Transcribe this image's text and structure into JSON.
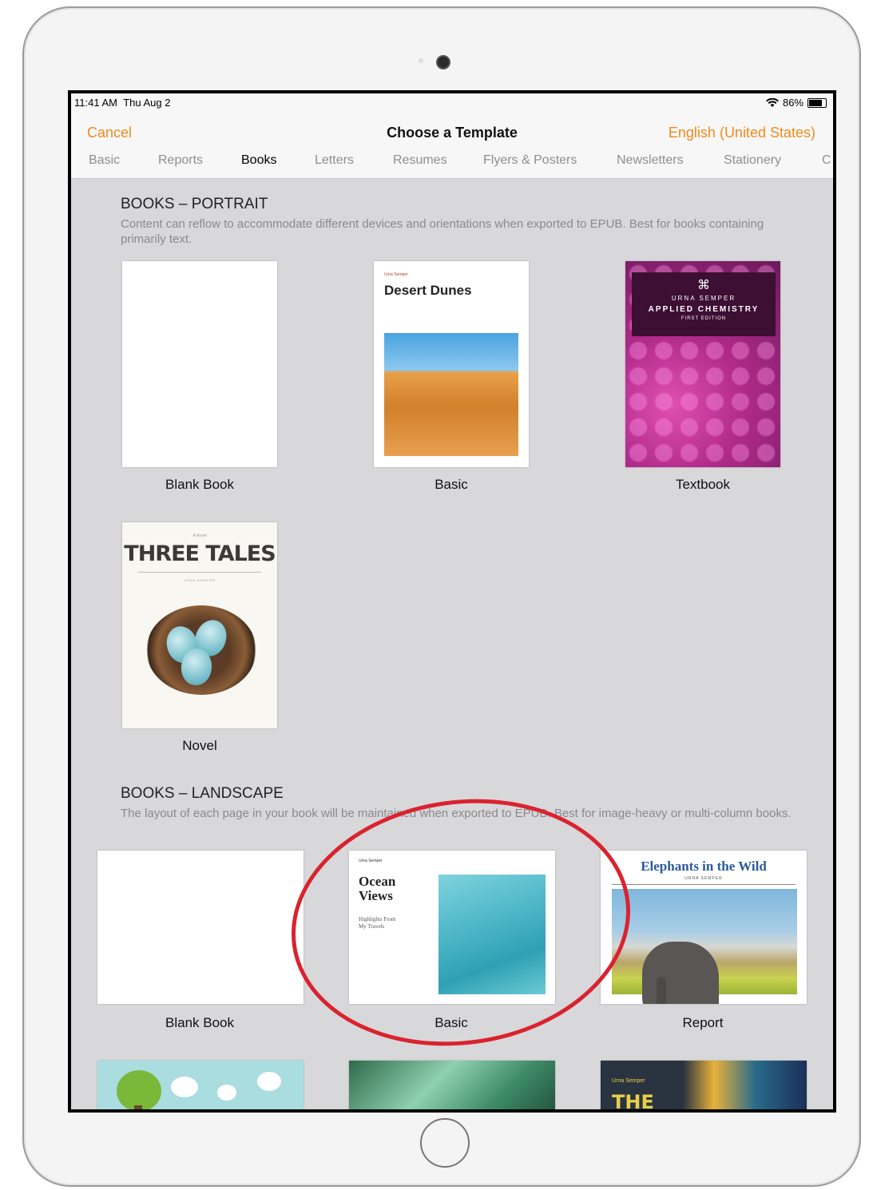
{
  "status": {
    "time": "11:41 AM",
    "date": "Thu Aug 2",
    "battery": "86%"
  },
  "nav": {
    "cancel": "Cancel",
    "title": "Choose a Template",
    "language": "English (United States)"
  },
  "tabs": [
    "Basic",
    "Reports",
    "Books",
    "Letters",
    "Resumes",
    "Flyers & Posters",
    "Newsletters",
    "Stationery",
    "C"
  ],
  "active_tab": "Books",
  "sections": {
    "portrait": {
      "title": "BOOKS – PORTRAIT",
      "description": "Content can reflow to accommodate different devices and orientations when exported to EPUB. Best for books containing primarily text."
    },
    "landscape": {
      "title": "BOOKS – LANDSCAPE",
      "description": "The layout of each page in your book will be maintained when exported to EPUB. Best for image-heavy or multi-column books."
    }
  },
  "portrait_templates": [
    {
      "label": "Blank Book"
    },
    {
      "label": "Basic",
      "cover_title": "Desert Dunes",
      "cover_author": "Urna Semper"
    },
    {
      "label": "Textbook",
      "cover_author": "URNA SEMPER",
      "cover_title": "APPLIED CHEMISTRY",
      "cover_edition": "FIRST EDITION"
    },
    {
      "label": "Novel",
      "cover_small": "A Novel",
      "cover_title": "THREE TALES",
      "cover_author": "URNA SEMPER"
    }
  ],
  "landscape_templates": [
    {
      "label": "Blank Book"
    },
    {
      "label": "Basic",
      "cover_author": "Urna Semper",
      "cover_title_1": "Ocean",
      "cover_title_2": "Views",
      "cover_sub_1": "Highlights From",
      "cover_sub_2": "My Travels"
    },
    {
      "label": "Report",
      "cover_title": "Elephants in the Wild",
      "cover_author": "URNA SEMPER"
    }
  ],
  "bottom_row": {
    "cover_author": "Urna Semper",
    "cover_title": "THE"
  },
  "colors": {
    "accent": "#f08a1c",
    "annotation": "#d9232f",
    "background": "#d8d8da"
  },
  "icons": {
    "wifi": "wifi-icon",
    "battery": "battery-icon"
  }
}
